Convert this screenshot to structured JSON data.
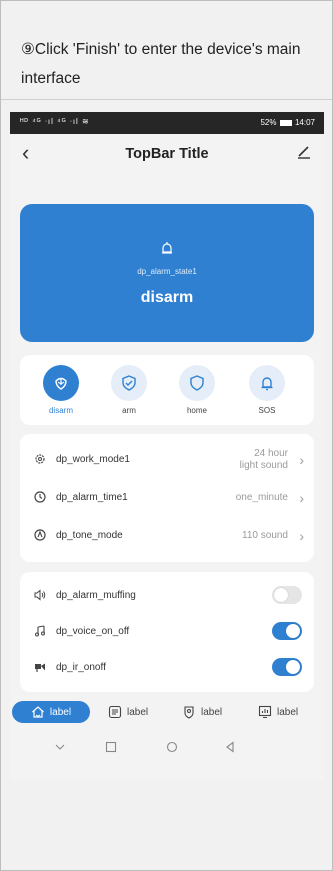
{
  "caption": "⑨Click 'Finish' to enter the device's main interface",
  "status_bar": {
    "left": "ᴴᴰ ⁴ᴳ ᐧıl ⁴ᴳ ᐧıl ≋",
    "battery": "52%",
    "time": "14:07"
  },
  "topbar": {
    "title": "TopBar Title",
    "back_icon": "chevron-left-icon",
    "edit_icon": "pencil-icon"
  },
  "status_card": {
    "state_label": "dp_alarm_state1",
    "state_value": "disarm",
    "color": "#2f80d1"
  },
  "modes": [
    {
      "label": "disarm",
      "icon": "shield-flower-icon",
      "active": true
    },
    {
      "label": "arm",
      "icon": "shield-check-icon",
      "active": false
    },
    {
      "label": "home",
      "icon": "shield-icon",
      "active": false
    },
    {
      "label": "SOS",
      "icon": "bell-icon",
      "active": false
    }
  ],
  "settings": [
    {
      "label": "dp_work_mode1",
      "value_line1": "24 hour",
      "value_line2": "light sound",
      "icon": "gear-icon"
    },
    {
      "label": "dp_alarm_time1",
      "value": "one_minute",
      "icon": "clock-icon"
    },
    {
      "label": "dp_tone_mode",
      "value": "110 sound",
      "icon": "alarm-icon"
    }
  ],
  "toggles": [
    {
      "label": "dp_alarm_muffing",
      "on": false,
      "icon": "speaker-icon"
    },
    {
      "label": "dp_voice_on_off",
      "on": true,
      "icon": "music-note-icon"
    },
    {
      "label": "dp_ir_onoff",
      "on": true,
      "icon": "camera-icon"
    }
  ],
  "tabs": [
    {
      "label": "label",
      "icon": "home-icon",
      "active": true
    },
    {
      "label": "label",
      "icon": "list-icon",
      "active": false
    },
    {
      "label": "label",
      "icon": "shield-user-icon",
      "active": false
    },
    {
      "label": "label",
      "icon": "chart-icon",
      "active": false
    }
  ],
  "nav": [
    "chevron-down-icon",
    "square-icon",
    "circle-icon",
    "triangle-back-icon"
  ]
}
